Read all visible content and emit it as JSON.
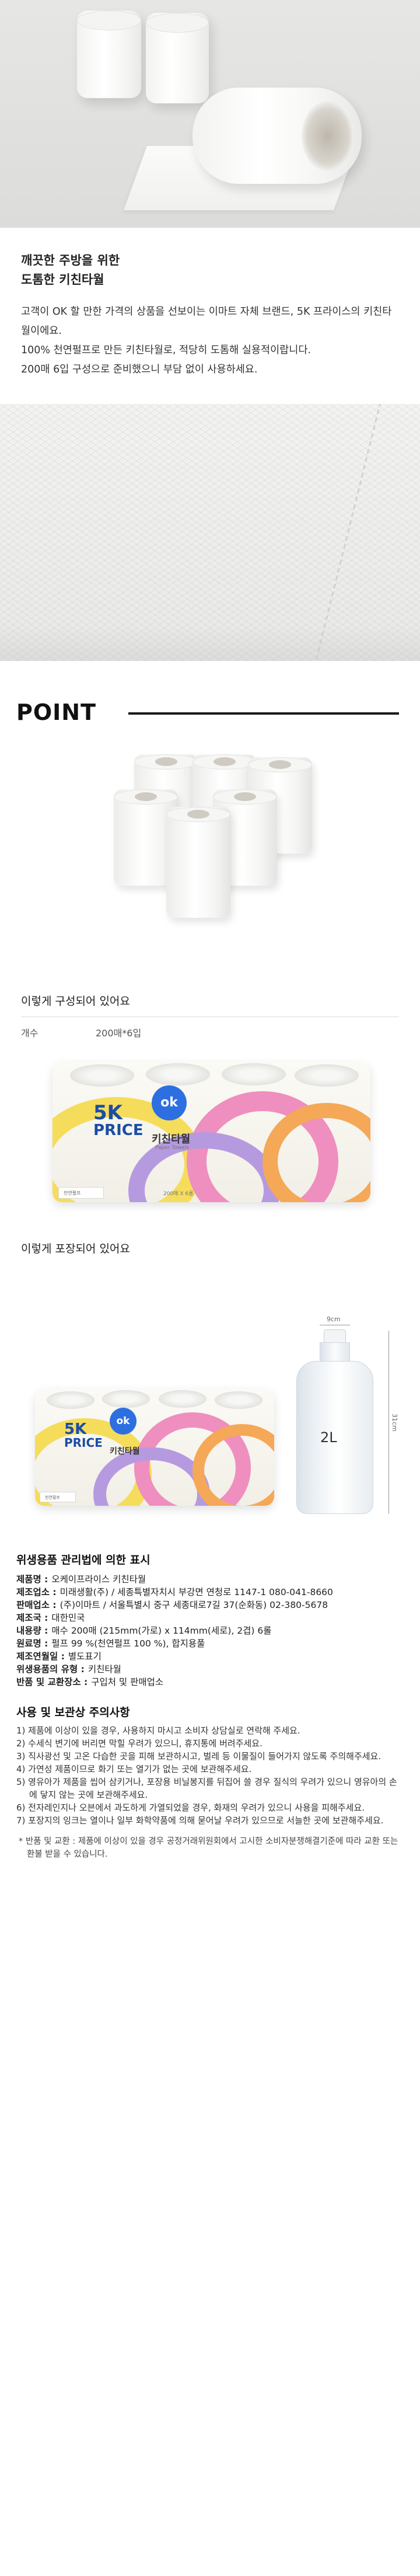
{
  "intro": {
    "title_line1": "깨끗한 주방을 위한",
    "title_line2": "도톰한 키친타월",
    "body": [
      "고객이 OK 할 만한 가격의 상품을 선보이는 이마트 자체 브랜드, 5K 프라이스의 키친타월이에요.",
      "100% 천연펄프로 만든 키친타월로, 적당히 도톰해 실용적이랍니다.",
      "200매 6입 구성으로 준비했으니 부담 없이 사용하세요."
    ]
  },
  "point": {
    "label": "POINT"
  },
  "composition": {
    "title": "이렇게 구성되어 있어요",
    "spec_key": "개수",
    "spec_value": "200매*6입"
  },
  "package": {
    "logo_line1": "5K",
    "logo_line2": "PRICE",
    "ok_badge": "ok",
    "product_name": "키친타월",
    "product_name_en": "Paper Towels",
    "count_label": "200매 X 6롤",
    "pulp_tag": "천연펄프",
    "title": "이렇게 포장되어 있어요"
  },
  "size_compare": {
    "bottle_width": "9cm",
    "bottle_height": "31cm",
    "bottle_volume": "2L"
  },
  "notice": {
    "title": "위생용품 관리법에 의한 표시",
    "info": [
      {
        "key": "제품명 :",
        "value": "오케이프라이스 키친타월"
      },
      {
        "key": "제조업소 :",
        "value": "미래생활(주) / 세종특별자치시 부강면 연청로 1147-1 080-041-8660"
      },
      {
        "key": "판매업소 :",
        "value": "(주)이마트 / 서울특별시 중구 세종대로7길 37(순화동) 02-380-5678"
      },
      {
        "key": "제조국 :",
        "value": "대한민국"
      },
      {
        "key": "내용량 :",
        "value": "매수 200매 (215mm(가로) x 114mm(세로), 2겹) 6롤"
      },
      {
        "key": "원료명 :",
        "value": "펄프 99 %(천연펄프 100 %), 합지용풀"
      },
      {
        "key": "제조연월일 :",
        "value": "별도표기"
      },
      {
        "key": "위생용품의 유형 :",
        "value": "키친타월"
      },
      {
        "key": "반품 및 교환장소 :",
        "value": "구입처 및 판매업소"
      }
    ],
    "caution_title": "사용 및 보관상 주의사항",
    "cautions": [
      "1) 제품에 이상이 있을 경우, 사용하지 마시고 소비자 상담실로 연락해 주세요.",
      "2) 수세식 변기에 버리면 막힐 우려가 있으니, 휴지통에 버려주세요.",
      "3) 직사광선 및 고온 다습한 곳을 피해 보관하시고, 벌레 등 이물질이 들어가지 않도록 주의해주세요.",
      "4) 가연성 제품이므로 화기 또는 열기가 없는 곳에 보관해주세요.",
      "5) 영유아가 제품을 씹어 삼키거나, 포장용 비닐봉지를 뒤집어 쓸 경우 질식의 우려가 있으니 영유아의 손에 닿지 않는 곳에 보관해주세요.",
      "6) 전자레인지나 오븐에서 과도하게 가열되었을 경우, 화재의 우려가 있으니 사용을 피해주세요.",
      "7) 포장지의 잉크는 열이나 일부 화학약품에 의해 묻어날 우려가 있으므로 서늘한 곳에 보관해주세요."
    ],
    "note": "* 반품 및 교환 : 제품에 이상이 있을 경우 공정거래위원회에서 고시한 소비자분쟁해결기준에 따라 교환 또는 환불 받을 수 있습니다."
  }
}
